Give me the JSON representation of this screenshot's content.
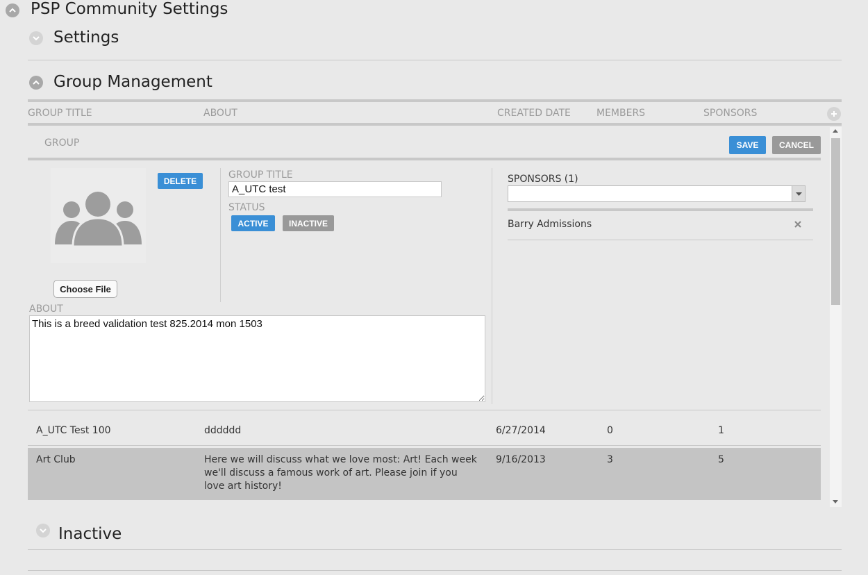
{
  "page": {
    "title": "PSP Community Settings"
  },
  "sections": {
    "settings": {
      "title": "Settings"
    },
    "group_management": {
      "title": "Group Management"
    },
    "inactive": {
      "title": "Inactive"
    }
  },
  "table": {
    "headers": {
      "group_title": "GROUP TITLE",
      "about": "ABOUT",
      "created_date": "CREATED DATE",
      "members": "MEMBERS",
      "sponsors": "SPONSORS"
    },
    "rows": [
      {
        "title": "A_UTC Test 100",
        "about": "dddddd",
        "created": "6/27/2014",
        "members": "0",
        "sponsors": "1"
      },
      {
        "title": "Art Club",
        "about": "Here we will discuss what we love most: Art! Each week we'll discuss a famous work of art. Please join if you love art history!",
        "created": "9/16/2013",
        "members": "3",
        "sponsors": "5"
      }
    ]
  },
  "editor": {
    "header_label": "GROUP",
    "save_label": "SAVE",
    "cancel_label": "CANCEL",
    "delete_label": "DELETE",
    "choose_file_label": "Choose File",
    "group_title_label": "GROUP TITLE",
    "group_title_value": "A_UTC test",
    "status_label": "STATUS",
    "active_label": "ACTIVE",
    "inactive_label": "INACTIVE",
    "about_label": "ABOUT",
    "about_value": "This is a breed validation test 825.2014 mon 1503",
    "sponsors_label": "SPONSORS (1)",
    "sponsor_select_value": "",
    "sponsors": [
      "Barry Admissions"
    ]
  },
  "colors": {
    "accent": "#3a8fd6",
    "muted_button": "#999999",
    "selected_row": "#c4c4c4",
    "background": "#e9e9e9"
  }
}
